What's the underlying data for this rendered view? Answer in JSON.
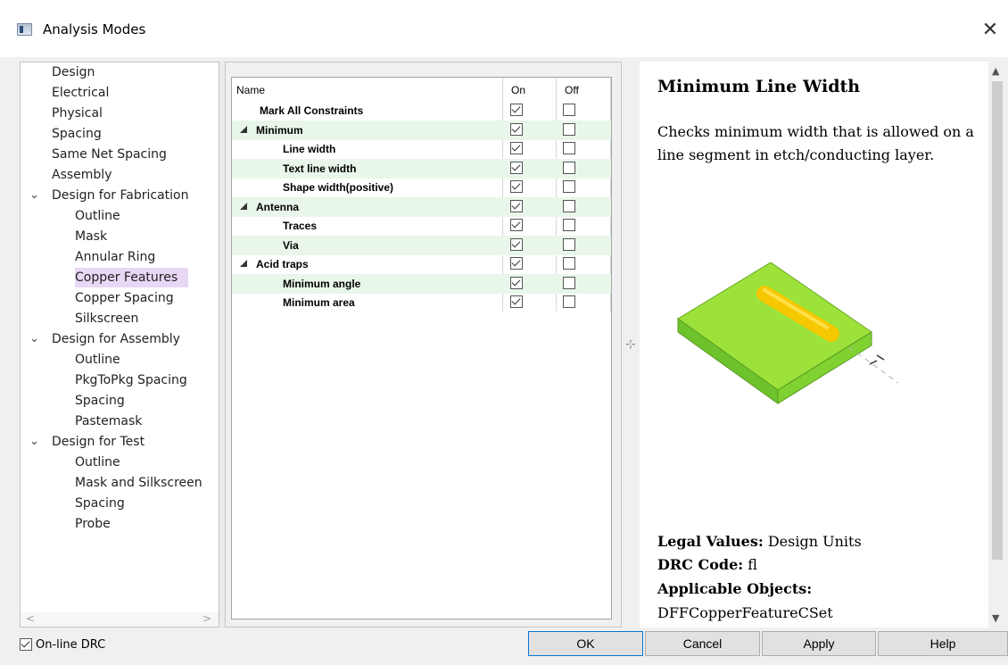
{
  "window": {
    "title": "Analysis Modes",
    "close_symbol": "✕"
  },
  "tree": {
    "items": [
      {
        "label": "Design",
        "level": 0
      },
      {
        "label": "Electrical",
        "level": 0
      },
      {
        "label": "Physical",
        "level": 0
      },
      {
        "label": "Spacing",
        "level": 0
      },
      {
        "label": "Same Net Spacing",
        "level": 0
      },
      {
        "label": "Assembly",
        "level": 0
      },
      {
        "label": "Design for Fabrication",
        "level": 0,
        "expanded": true
      },
      {
        "label": "Outline",
        "level": 1
      },
      {
        "label": "Mask",
        "level": 1
      },
      {
        "label": "Annular Ring",
        "level": 1
      },
      {
        "label": "Copper Features",
        "level": 1,
        "selected": true
      },
      {
        "label": "Copper Spacing",
        "level": 1
      },
      {
        "label": "Silkscreen",
        "level": 1
      },
      {
        "label": "Design for Assembly",
        "level": 0,
        "expanded": true
      },
      {
        "label": "Outline",
        "level": 1
      },
      {
        "label": "PkgToPkg Spacing",
        "level": 1
      },
      {
        "label": "Spacing",
        "level": 1
      },
      {
        "label": "Pastemask",
        "level": 1
      },
      {
        "label": "Design for Test",
        "level": 0,
        "expanded": true
      },
      {
        "label": "Outline",
        "level": 1
      },
      {
        "label": "Mask and Silkscreen",
        "level": 1
      },
      {
        "label": "Spacing",
        "level": 1
      },
      {
        "label": "Probe",
        "level": 1
      }
    ]
  },
  "grid": {
    "headers": {
      "name": "Name",
      "on": "On",
      "off": "Off"
    },
    "rows": [
      {
        "label": "Mark All Constraints",
        "level": 1,
        "on": true,
        "off": false
      },
      {
        "label": "Minimum",
        "level": 0,
        "group": true,
        "on": true,
        "off": false
      },
      {
        "label": "Line width",
        "level": 2,
        "on": true,
        "off": false
      },
      {
        "label": "Text line width",
        "level": 2,
        "on": true,
        "off": false
      },
      {
        "label": "Shape width(positive)",
        "level": 2,
        "on": true,
        "off": false
      },
      {
        "label": "Antenna",
        "level": 0,
        "group": true,
        "on": true,
        "off": false
      },
      {
        "label": "Traces",
        "level": 2,
        "on": true,
        "off": false
      },
      {
        "label": "Via",
        "level": 2,
        "on": true,
        "off": false
      },
      {
        "label": "Acid traps",
        "level": 0,
        "group": true,
        "on": true,
        "off": false
      },
      {
        "label": "Minimum angle",
        "level": 2,
        "on": true,
        "off": false
      },
      {
        "label": "Minimum area",
        "level": 2,
        "on": true,
        "off": false
      }
    ]
  },
  "help": {
    "title": "Minimum Line Width",
    "description": "Checks minimum width that is allowed on a line segment in etch/conducting layer.",
    "legal_values_label": "Legal Values:",
    "legal_values": "Design Units",
    "drc_code_label": "DRC Code:",
    "drc_code": "fl",
    "applicable_objects_label": "Applicable Objects:",
    "applicable_objects": "DFFCopperFeatureCSet"
  },
  "footer": {
    "online_drc_label": "On-line DRC",
    "online_drc_checked": true,
    "ok": "OK",
    "cancel": "Cancel",
    "apply": "Apply",
    "help": "Help"
  },
  "colors": {
    "selection": "#e8d7f5",
    "row_alt": "#e9f6ea",
    "board_green": "#9ce23a",
    "trace_yellow": "#f5c800",
    "default_button_border": "#0078d7"
  }
}
